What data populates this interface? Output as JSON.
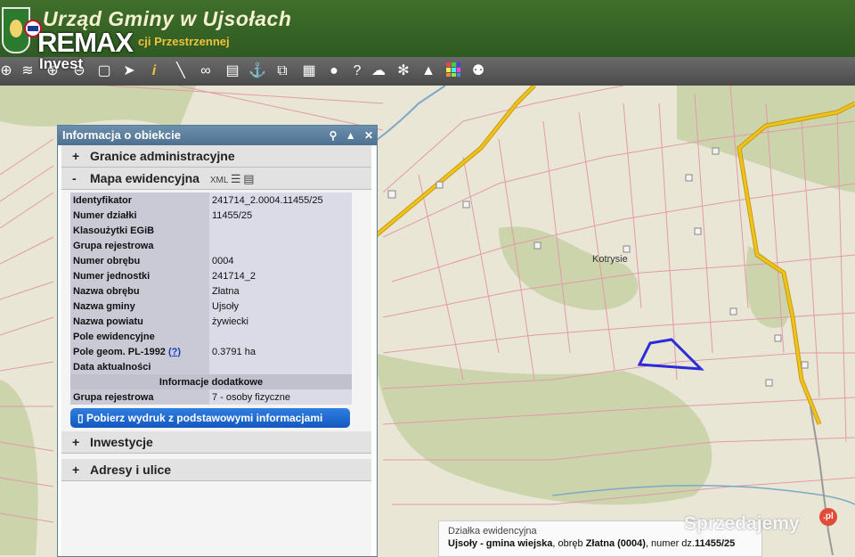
{
  "header": {
    "title": "Urząd Gminy w Ujsołach",
    "subtitle": "cji Przestrzennej",
    "watermark_brand": "REMAX",
    "watermark_sub": "Invest"
  },
  "toolbar": {
    "icons": [
      "globe-icon",
      "layers-icon",
      "zoom-in-icon",
      "zoom-out-icon",
      "zoom-extent-icon",
      "pointer-icon",
      "info-icon",
      "measure-icon",
      "link-icon",
      "print-icon",
      "person-icon",
      "copy-icon",
      "panel-icon",
      "comment-icon",
      "help-icon",
      "cloud-download-icon",
      "settings-icon",
      "road-icon",
      "grid-color-icon",
      "share-icon"
    ]
  },
  "map": {
    "place_label": "Kotrysie",
    "colors": {
      "background": "#e9e6d6",
      "forest": "#c9d2a9",
      "parcel": "#e39aa8",
      "road": "#f0c21c",
      "highlight": "#2b2bd9",
      "river": "#7ea7c8"
    }
  },
  "panel": {
    "title": "Informacja o obiekcie",
    "sections": {
      "admin": "Granice administracyjne",
      "map": "Mapa ewidencyjna",
      "map_xml": "XML",
      "investments": "Inwestycje",
      "addresses": "Adresy i ulice"
    },
    "rows": [
      {
        "key": "Identyfikator",
        "value": "241714_2.0004.11455/25"
      },
      {
        "key": "Numer działki",
        "value": "11455/25"
      },
      {
        "key": "Klasoużytki EGiB",
        "value": ""
      },
      {
        "key": "Grupa rejestrowa",
        "value": ""
      },
      {
        "key": "Numer obrębu",
        "value": "0004"
      },
      {
        "key": "Numer jednostki",
        "value": "241714_2"
      },
      {
        "key": "Nazwa obrębu",
        "value": "Złatna"
      },
      {
        "key": "Nazwa gminy",
        "value": "Ujsoły"
      },
      {
        "key": "Nazwa powiatu",
        "value": "żywiecki"
      },
      {
        "key": "Pole ewidencyjne",
        "value": ""
      },
      {
        "key": "Pole geom. PL-1992",
        "key_help": "(?)",
        "value": "0.3791 ha"
      },
      {
        "key": "Data aktualności",
        "value": ""
      }
    ],
    "extra_header": "Informacje dodatkowe",
    "extra_row": {
      "key": "Grupa rejestrowa",
      "value": "7 - osoby fizyczne"
    },
    "download_button": "Pobierz wydruk z podstawowymi informacjami"
  },
  "info_box": {
    "line1": "Działka ewidencyjna",
    "gmina": "Ujsoły - gmina wiejska",
    "obreb_label": ", obręb ",
    "obreb": "Złatna (0004)",
    "numer_label": ", numer dz.",
    "numer": "11455/25"
  },
  "watermark": {
    "site": "Sprzedajemy",
    "tld": ".pl"
  }
}
